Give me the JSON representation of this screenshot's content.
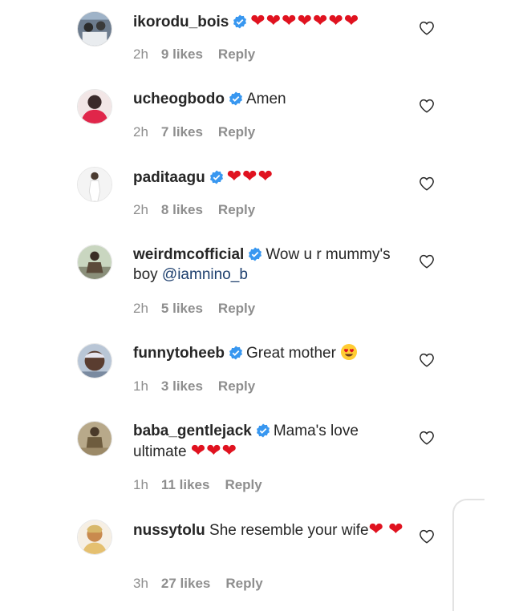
{
  "comments": [
    {
      "username": "ikorodu_bois",
      "verified": true,
      "text": "",
      "emoji": "❤❤❤❤❤❤❤",
      "time": "2h",
      "likes": "9 likes",
      "reply": "Reply"
    },
    {
      "username": "ucheogbodo",
      "verified": true,
      "text": "Amen",
      "emoji": "",
      "time": "2h",
      "likes": "7 likes",
      "reply": "Reply"
    },
    {
      "username": "paditaagu",
      "verified": true,
      "text": "",
      "emoji": "❤❤❤",
      "time": "2h",
      "likes": "8 likes",
      "reply": "Reply"
    },
    {
      "username": "weirdmcofficial",
      "verified": true,
      "text": "Wow u r mummy's boy ",
      "mention": "@iamnino_b",
      "time": "2h",
      "likes": "5 likes",
      "reply": "Reply"
    },
    {
      "username": "funnytoheeb",
      "verified": true,
      "text": "Great mother ",
      "emoji_face": "smiling-face-with-heart-eyes",
      "time": "1h",
      "likes": "3 likes",
      "reply": "Reply"
    },
    {
      "username": "baba_gentlejack",
      "verified": true,
      "text": "Mama's love ultimate ",
      "emoji": "❤❤❤",
      "time": "1h",
      "likes": "11 likes",
      "reply": "Reply"
    },
    {
      "username": "nussytolu",
      "verified": false,
      "text": "She resemble your wife",
      "emoji": "❤",
      "emoji2": "❤",
      "time": "3h",
      "likes": "27 likes",
      "reply": "Reply"
    }
  ],
  "colors": {
    "heart": "#e0121f",
    "verified": "#3897f0",
    "meta": "#8e8e8e",
    "mention": "#1d3f6e"
  },
  "icons": {
    "like": "heart-outline-icon",
    "verified": "verified-badge-icon"
  }
}
